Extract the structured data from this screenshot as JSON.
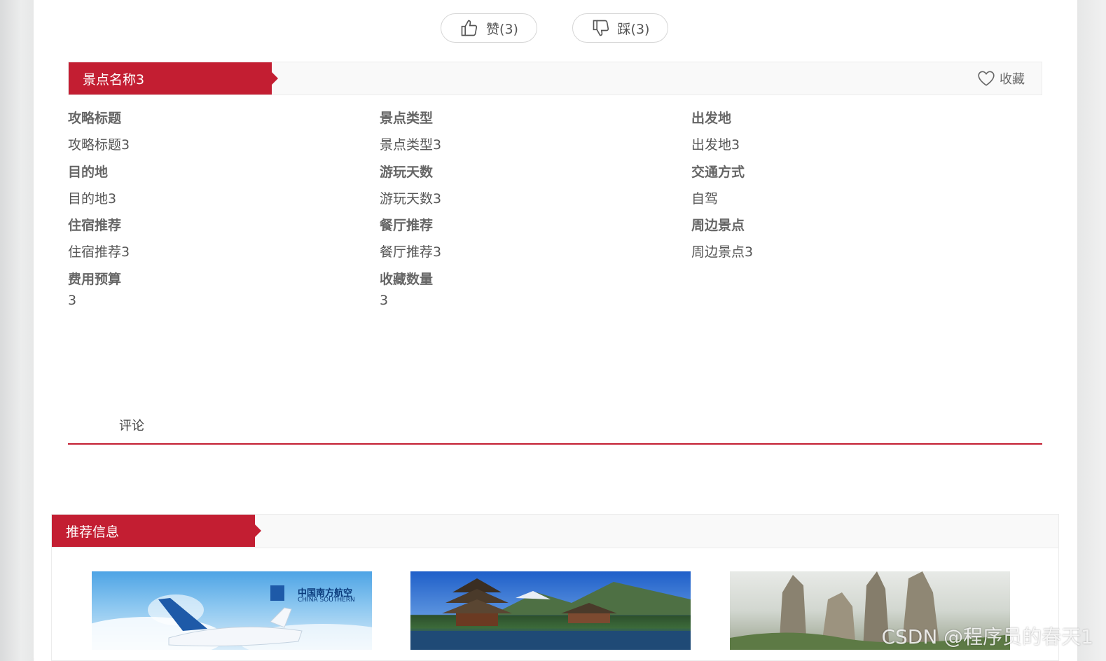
{
  "vote": {
    "like_label": "赞(3)",
    "dislike_label": "踩(3)"
  },
  "detail": {
    "title": "景点名称3",
    "favorite_label": "收藏",
    "fields": [
      {
        "label": "攻略标题",
        "value": "攻略标题3"
      },
      {
        "label": "景点类型",
        "value": "景点类型3"
      },
      {
        "label": "出发地",
        "value": "出发地3"
      },
      {
        "label": "目的地",
        "value": "目的地3"
      },
      {
        "label": "游玩天数",
        "value": "游玩天数3"
      },
      {
        "label": "交通方式",
        "value": "自驾"
      },
      {
        "label": "住宿推荐",
        "value": "住宿推荐3"
      },
      {
        "label": "餐厅推荐",
        "value": "餐厅推荐3"
      },
      {
        "label": "周边景点",
        "value": "周边景点3"
      },
      {
        "label": "费用预算",
        "value": "3"
      },
      {
        "label": "收藏数量",
        "value": "3"
      }
    ]
  },
  "comments": {
    "tab_label": "评论"
  },
  "recommend": {
    "title": "推荐信息",
    "airline_name_cn": "中国南方航空",
    "airline_name_en": "CHINA SOUTHERN"
  },
  "watermark": "CSDN @程序员的春天1"
}
